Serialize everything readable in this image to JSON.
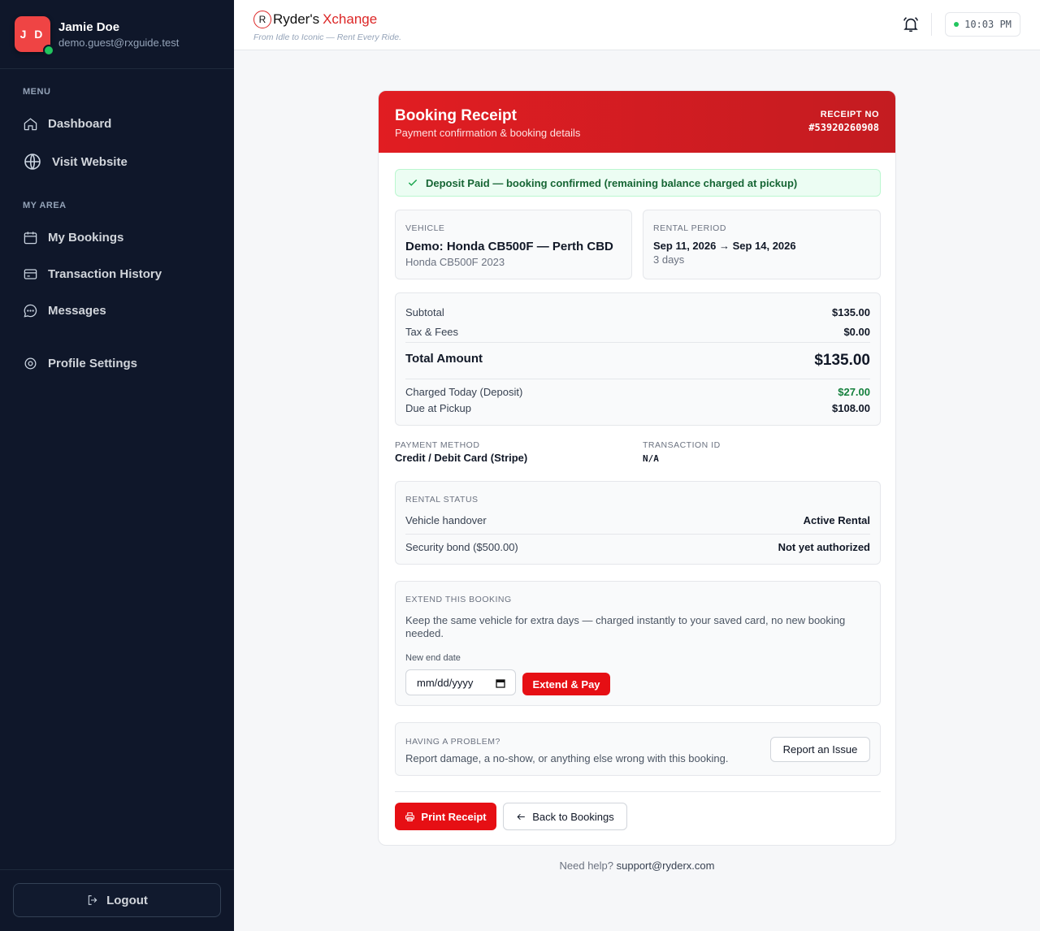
{
  "user": {
    "initials": "J D",
    "name": "Jamie Doe",
    "email": "demo.guest@rxguide.test"
  },
  "sidebar": {
    "menu_heading": "MENU",
    "menu_items": [
      {
        "label": "Dashboard",
        "icon": "home-icon"
      },
      {
        "label": "Visit Website",
        "icon": "globe-icon"
      }
    ],
    "area_heading": "MY AREA",
    "area_items": [
      {
        "label": "My Bookings",
        "icon": "calendar-icon"
      },
      {
        "label": "Transaction History",
        "icon": "credit-card-icon"
      },
      {
        "label": "Messages",
        "icon": "chat-icon"
      },
      {
        "label": "Profile Settings",
        "icon": "settings-icon"
      }
    ],
    "logout_label": "Logout"
  },
  "header": {
    "logo_mark": "R",
    "logo_ryder": "Ryder's",
    "logo_x": "Xchange",
    "tagline": "From Idle to Iconic — Rent Every Ride.",
    "time": "10:03 PM"
  },
  "receipt": {
    "title": "Booking Receipt",
    "subtitle": "Payment confirmation & booking details",
    "receipt_label": "RECEIPT NO",
    "receipt_no": "#53920260908",
    "alert": "Deposit Paid — booking confirmed (remaining balance charged at pickup)",
    "vehicle": {
      "label": "VEHICLE",
      "name": "Demo: Honda CB500F — Perth CBD",
      "model": "Honda CB500F 2023"
    },
    "period": {
      "label": "RENTAL PERIOD",
      "dates": "Sep 11, 2026 → Sep 14, 2026",
      "days": "3 days"
    },
    "totals": {
      "subtotal_label": "Subtotal",
      "subtotal": "$135.00",
      "tax_label": "Tax & Fees",
      "tax": "$0.00",
      "total_label": "Total Amount",
      "total": "$135.00",
      "charged_label": "Charged Today (Deposit)",
      "charged": "$27.00",
      "due_label": "Due at Pickup",
      "due": "$108.00"
    },
    "payment": {
      "label": "PAYMENT METHOD",
      "value": "Credit / Debit Card (Stripe)"
    },
    "transaction": {
      "label": "TRANSACTION ID",
      "value": "N/A"
    },
    "status": {
      "label": "RENTAL STATUS",
      "handover_label": "Vehicle handover",
      "handover": "Active Rental",
      "bond_label": "Security bond ($500.00)",
      "bond": "Not yet authorized"
    },
    "extend": {
      "label": "EXTEND THIS BOOKING",
      "description": "Keep the same vehicle for extra days — charged instantly to your saved card, no new booking needed.",
      "date_label": "New end date",
      "date_placeholder": "mm/dd/yyyy",
      "button": "Extend & Pay"
    },
    "problem": {
      "label": "HAVING A PROBLEM?",
      "description": "Report damage, a no-show, or anything else wrong with this booking.",
      "button": "Report an Issue"
    },
    "print_button": "Print Receipt",
    "back_button": "Back to Bookings"
  },
  "footer": {
    "help_text": "Need help?",
    "email": "support@ryderx.com"
  },
  "colors": {
    "accent": "#e60f14",
    "sidebar": "#0f172a",
    "success": "#15803d"
  }
}
